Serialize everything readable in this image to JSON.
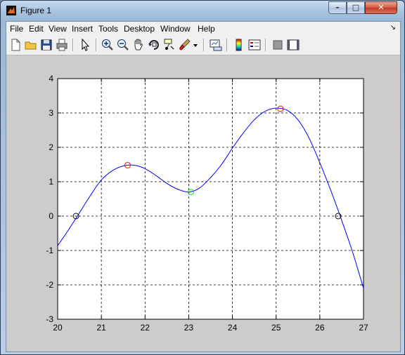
{
  "window": {
    "title": "Figure 1",
    "controls": {
      "minimize": "–",
      "maximize": "□",
      "close": "✕"
    }
  },
  "menubar": {
    "items": [
      {
        "label": "File"
      },
      {
        "label": "Edit"
      },
      {
        "label": "View"
      },
      {
        "label": "Insert"
      },
      {
        "label": "Tools"
      },
      {
        "label": "Desktop"
      },
      {
        "label": "Window"
      },
      {
        "label": "Help"
      }
    ],
    "dock_icon": "dock-arrow-icon"
  },
  "toolbar": {
    "buttons": [
      "new-figure-icon",
      "open-file-icon",
      "save-icon",
      "print-icon",
      "edit-plot-arrow-icon",
      "zoom-in-icon",
      "zoom-out-icon",
      "pan-hand-icon",
      "rotate-3d-icon",
      "data-cursor-icon",
      "brush-icon",
      "brush-dropdown-icon",
      "link-plot-icon",
      "insert-colorbar-icon",
      "insert-legend-icon",
      "hide-plot-tools-icon",
      "show-plot-tools-icon"
    ]
  },
  "chart_data": {
    "type": "line",
    "title": "",
    "xlabel": "",
    "ylabel": "",
    "xlim": [
      20,
      27
    ],
    "ylim": [
      -3,
      4
    ],
    "grid": true,
    "x_ticks": [
      "20",
      "21",
      "22",
      "23",
      "24",
      "25",
      "26",
      "27"
    ],
    "y_ticks": [
      "-3",
      "-2",
      "-1",
      "0",
      "1",
      "2",
      "3",
      "4"
    ],
    "series": [
      {
        "style": "line",
        "color": "#0000ff",
        "x": [
          20.0,
          20.25,
          20.5,
          20.75,
          21.0,
          21.25,
          21.5,
          21.75,
          22.0,
          22.25,
          22.5,
          22.75,
          23.0,
          23.25,
          23.5,
          23.75,
          24.0,
          24.25,
          24.5,
          24.75,
          25.0,
          25.25,
          25.5,
          25.75,
          26.0,
          26.25,
          26.5,
          26.75,
          27.0
        ],
        "y": [
          -0.86,
          -0.4,
          0.1,
          0.6,
          1.05,
          1.32,
          1.46,
          1.48,
          1.38,
          1.18,
          0.95,
          0.78,
          0.7,
          0.82,
          1.12,
          1.5,
          1.98,
          2.42,
          2.8,
          3.05,
          3.14,
          3.08,
          2.8,
          2.28,
          1.55,
          0.75,
          -0.12,
          -1.05,
          -2.1
        ]
      },
      {
        "style": "markers",
        "marker": "circle",
        "color": "#ff0000",
        "x": [
          21.6,
          25.1
        ],
        "y": [
          1.48,
          3.12
        ]
      },
      {
        "style": "markers",
        "marker": "circle",
        "color": "#00ff00",
        "x": [
          23.05
        ],
        "y": [
          0.7
        ]
      },
      {
        "style": "markers",
        "marker": "circle",
        "color": "#000000",
        "x": [
          20.42,
          26.42
        ],
        "y": [
          0.0,
          0.0
        ]
      }
    ]
  }
}
